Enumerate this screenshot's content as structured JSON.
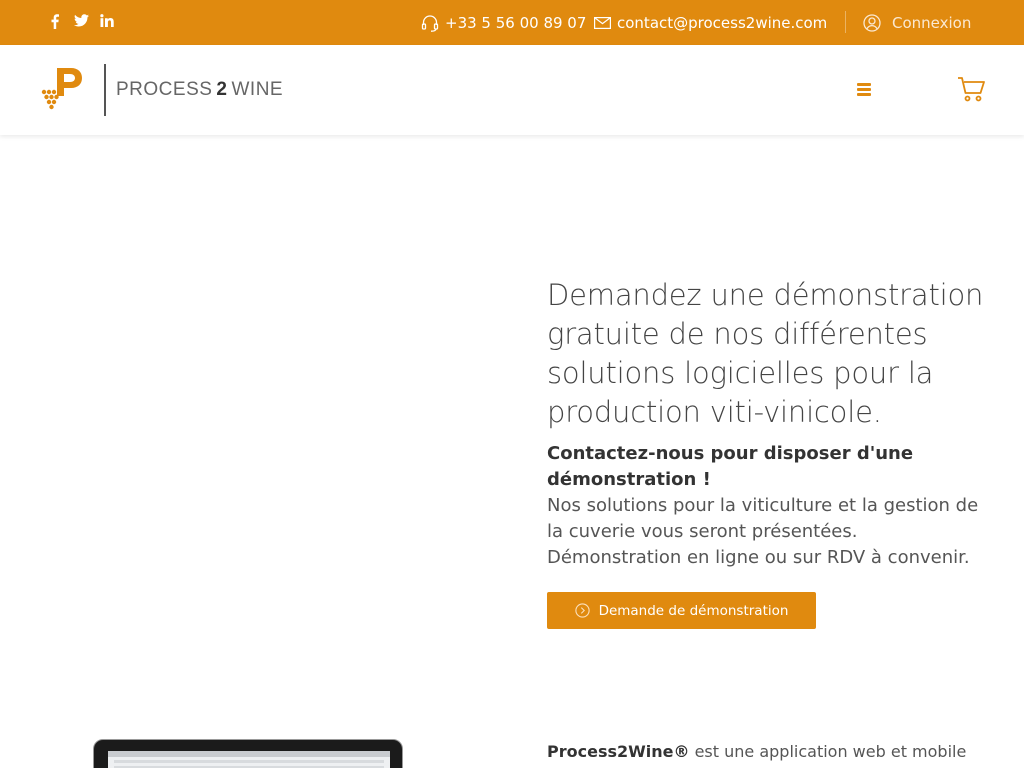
{
  "topbar": {
    "social": [
      {
        "name": "facebook-icon",
        "glyph": "f"
      },
      {
        "name": "twitter-icon",
        "glyph": ""
      },
      {
        "name": "linkedin-icon",
        "glyph": "in"
      }
    ],
    "phone": "+33 5 56 00 89 07",
    "email": "contact@process2wine.com",
    "login": "Connexion"
  },
  "header": {
    "logo": {
      "left": "PROCESS",
      "num": "2",
      "right": "WINE"
    },
    "menu_icon": "hamburger-menu-icon",
    "cart_icon": "shopping-cart-icon"
  },
  "hero": {
    "title": "Demandez une démonstration gratuite de nos différentes solutions logicielles pour la production viti-vinicole.",
    "strong": "Contactez-nous pour disposer d'une démonstration !",
    "p1": "Nos solutions pour la viticulture et la gestion de la cuverie vous seront présentées.",
    "p2": "Démonstration en ligne ou sur RDV à convenir.",
    "button": "Demande de démonstration"
  },
  "bottom": {
    "brand": "Process2Wine®",
    "text": " est une application web et mobile"
  },
  "colors": {
    "accent": "#e08a0f",
    "text": "#444444"
  }
}
